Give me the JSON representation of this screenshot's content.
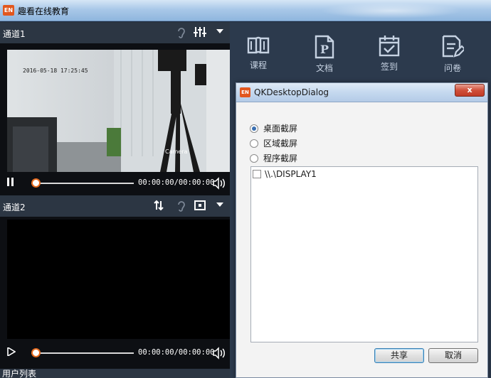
{
  "window": {
    "title": "趣看在线教育",
    "icon_text": "EN"
  },
  "channels": [
    {
      "name": "通道1",
      "overlay_timestamp": "2016-05-18  17:25:45",
      "overlay_camera": "Camera",
      "time": "00:00:00/00:00:00",
      "playing": true
    },
    {
      "name": "通道2",
      "time": "00:00:00/00:00:00",
      "playing": false
    }
  ],
  "user_list_label": "用户列表",
  "toolbar": [
    {
      "label": "课程",
      "icon": "book-icon"
    },
    {
      "label": "文档",
      "icon": "document-icon"
    },
    {
      "label": "签到",
      "icon": "calendar-check-icon"
    },
    {
      "label": "问卷",
      "icon": "survey-edit-icon"
    }
  ],
  "dialog": {
    "title": "QKDesktopDialog",
    "close": "x",
    "options": [
      {
        "label": "桌面截屏",
        "selected": true
      },
      {
        "label": "区域截屏",
        "selected": false
      },
      {
        "label": "程序截屏",
        "selected": false
      }
    ],
    "list_items": [
      "\\\\.\\DISPLAY1"
    ],
    "share_button": "共享",
    "cancel_button": "取消"
  },
  "colors": {
    "accent": "#e36a1f",
    "panel": "#2c3a4d",
    "header": "#2c3643"
  }
}
